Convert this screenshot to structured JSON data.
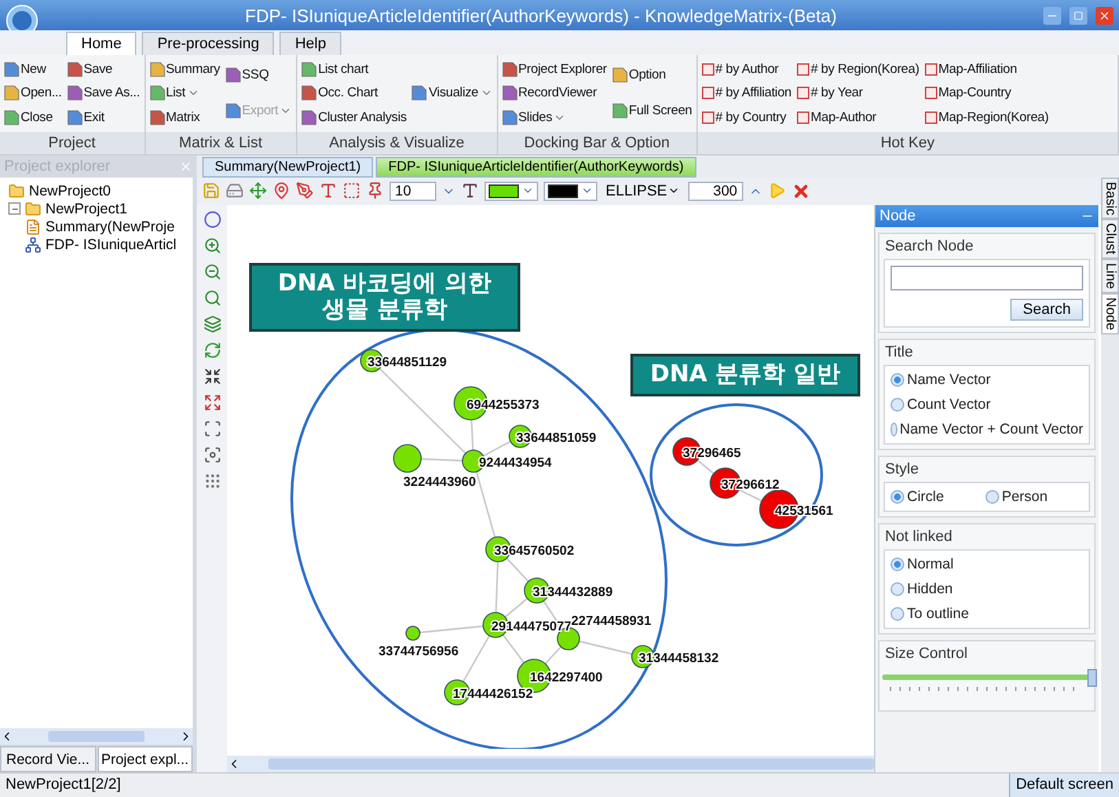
{
  "window": {
    "title": "FDP- ISIuniqueArticleIdentifier(AuthorKeywords) - KnowledgeMatrix-(Beta)"
  },
  "ribbon_tabs": [
    {
      "label": "Home",
      "selected": true
    },
    {
      "label": "Pre-processing",
      "selected": false
    },
    {
      "label": "Help",
      "selected": false
    }
  ],
  "ribbon_groups": [
    {
      "label": "Project",
      "columns": [
        [
          {
            "label": "New"
          },
          {
            "label": "Open..."
          },
          {
            "label": "Close"
          }
        ],
        [
          {
            "label": "Save"
          },
          {
            "label": "Save As..."
          },
          {
            "label": "Exit"
          }
        ]
      ]
    },
    {
      "label": "Matrix & List",
      "columns": [
        [
          {
            "label": "Summary"
          },
          {
            "label": "List",
            "dropdown": true
          },
          {
            "label": "Matrix"
          }
        ],
        [
          {
            "label": "SSQ"
          },
          {
            "label": "Export",
            "dropdown": true,
            "disabled": true
          }
        ]
      ]
    },
    {
      "label": "Analysis & Visualize",
      "columns": [
        [
          {
            "label": "List chart"
          },
          {
            "label": "Occ. Chart"
          },
          {
            "label": "Cluster Analysis"
          }
        ],
        [
          {
            "label": "Visualize",
            "dropdown": true
          }
        ]
      ]
    },
    {
      "label": "Docking Bar & Option",
      "columns": [
        [
          {
            "label": "Project Explorer"
          },
          {
            "label": "RecordViewer"
          },
          {
            "label": "Slides",
            "dropdown": true
          }
        ],
        [
          {
            "label": "Option"
          },
          {
            "label": "Full Screen"
          }
        ]
      ]
    },
    {
      "label": "Hot Key",
      "columns": [
        [
          {
            "label": "# by Author"
          },
          {
            "label": "# by Affiliation"
          },
          {
            "label": "# by Country"
          }
        ],
        [
          {
            "label": "# by Region(Korea)"
          },
          {
            "label": "# by Year"
          },
          {
            "label": "Map-Author"
          }
        ],
        [
          {
            "label": "Map-Affiliation"
          },
          {
            "label": "Map-Country"
          },
          {
            "label": "Map-Region(Korea)"
          }
        ]
      ]
    }
  ],
  "project_explorer": {
    "title": "Project explorer",
    "tree": [
      {
        "label": "NewProject0"
      },
      {
        "label": "NewProject1",
        "expanded": true,
        "children": [
          {
            "label": "Summary(NewProje",
            "kind": "summary"
          },
          {
            "label": "FDP- ISIuniqueArticl",
            "kind": "network"
          }
        ]
      }
    ],
    "tabs": [
      {
        "label": "Record Vie...",
        "selected": false
      },
      {
        "label": "Project expl...",
        "selected": true
      }
    ]
  },
  "document_tabs": [
    {
      "label": "Summary(NewProject1)",
      "selected": false
    },
    {
      "label": "FDP- ISIuniqueArticleIdentifier(AuthorKeywords)",
      "selected": true
    }
  ],
  "toolbar": {
    "size_value": "10",
    "swatches": [
      {
        "color": "#66dd00"
      },
      {
        "color": "#000000"
      }
    ],
    "shape": "ELLIPSE",
    "count_value": "300"
  },
  "annotations": [
    {
      "text": "DNA 바코딩에 의한 생물 분류학"
    },
    {
      "text": "DNA 분류학 일반"
    }
  ],
  "graph": {
    "nodes": [
      {
        "label": "33644851129",
        "color": "#77e000"
      },
      {
        "label": "6944255373",
        "color": "#77e000"
      },
      {
        "label": "33644851059",
        "color": "#77e000"
      },
      {
        "label": "3224443960",
        "color": "#77e000"
      },
      {
        "label": "9244434954",
        "color": "#77e000"
      },
      {
        "label": "33645760502",
        "color": "#77e000"
      },
      {
        "label": "31344432889",
        "color": "#77e000"
      },
      {
        "label": "29144475077",
        "color": "#77e000"
      },
      {
        "label": "33744756956",
        "color": "#77e000"
      },
      {
        "label": "22744458931",
        "color": "#77e000"
      },
      {
        "label": "31344458132",
        "color": "#77e000"
      },
      {
        "label": "1642297400",
        "color": "#77e000"
      },
      {
        "label": "17444426152",
        "color": "#77e000"
      },
      {
        "label": "37296465",
        "color": "#ee0000"
      },
      {
        "label": "37296612",
        "color": "#ee0000"
      },
      {
        "label": "42531561",
        "color": "#ee0000"
      }
    ]
  },
  "node_panel": {
    "title": "Node",
    "search": {
      "label": "Search Node",
      "button": "Search"
    },
    "groups": [
      {
        "label": "Title",
        "kind": "column",
        "options": [
          {
            "label": "Name Vector",
            "selected": true
          },
          {
            "label": "Count Vector",
            "selected": false
          },
          {
            "label": "Name Vector + Count Vector",
            "selected": false
          }
        ]
      },
      {
        "label": "Style",
        "kind": "row",
        "options": [
          {
            "label": "Circle",
            "selected": true
          },
          {
            "label": "Person",
            "selected": false
          }
        ]
      },
      {
        "label": "Not linked",
        "kind": "column",
        "options": [
          {
            "label": "Normal",
            "selected": true
          },
          {
            "label": "Hidden",
            "selected": false
          },
          {
            "label": "To outline",
            "selected": false
          }
        ]
      }
    ],
    "size_control": {
      "label": "Size Control",
      "level": 1
    }
  },
  "side_tabs": [
    {
      "label": "Basic",
      "selected": false
    },
    {
      "label": "Clust",
      "selected": false
    },
    {
      "label": "Line",
      "selected": false
    },
    {
      "label": "Node",
      "selected": true
    }
  ],
  "status_bar": {
    "left": "NewProject1[2/2]",
    "right": "Default screen"
  }
}
